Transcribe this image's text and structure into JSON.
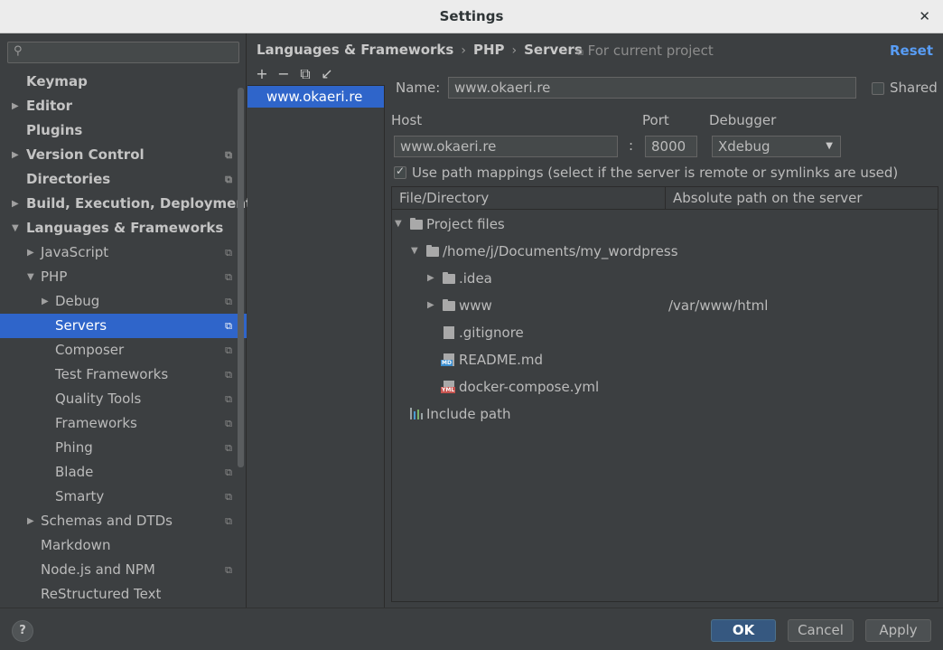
{
  "window": {
    "title": "Settings",
    "close_glyph": "✕"
  },
  "sidebar": {
    "search_placeholder": "",
    "search_icon": "search-icon",
    "items": [
      {
        "label": "Keymap"
      },
      {
        "label": "Editor"
      },
      {
        "label": "Plugins"
      },
      {
        "label": "Version Control"
      },
      {
        "label": "Directories"
      },
      {
        "label": "Build, Execution, Deployment"
      },
      {
        "label": "Languages & Frameworks"
      },
      {
        "label": "JavaScript"
      },
      {
        "label": "PHP"
      },
      {
        "label": "Debug"
      },
      {
        "label": "Servers"
      },
      {
        "label": "Composer"
      },
      {
        "label": "Test Frameworks"
      },
      {
        "label": "Quality Tools"
      },
      {
        "label": "Frameworks"
      },
      {
        "label": "Phing"
      },
      {
        "label": "Blade"
      },
      {
        "label": "Smarty"
      },
      {
        "label": "Schemas and DTDs"
      },
      {
        "label": "Markdown"
      },
      {
        "label": "Node.js and NPM"
      },
      {
        "label": "ReStructured Text"
      }
    ]
  },
  "header": {
    "breadcrumb": [
      "Languages & Frameworks",
      "PHP",
      "Servers"
    ],
    "breadcrumb_sep": "›",
    "scope_note": "For current project",
    "reset_label": "Reset"
  },
  "servers": {
    "toolbar": [
      "+",
      "−",
      "⧉",
      "↙"
    ],
    "list": [
      "www.okaeri.re"
    ]
  },
  "form": {
    "name_label": "Name:",
    "name_value": "www.okaeri.re",
    "shared_label": "Shared",
    "host_label": "Host",
    "host_value": "www.okaeri.re",
    "port_label": "Port",
    "port_sep": ":",
    "port_value": "8000",
    "debugger_label": "Debugger",
    "debugger_value": "Xdebug",
    "use_mappings_label": "Use path mappings (select if the server is remote or symlinks are used)"
  },
  "mappings": {
    "columns": [
      "File/Directory",
      "Absolute path on the server"
    ],
    "rows": [
      {
        "name": "Project files",
        "abs": ""
      },
      {
        "name": "/home/j/Documents/my_wordpress",
        "abs": ""
      },
      {
        "name": ".idea",
        "abs": ""
      },
      {
        "name": "www",
        "abs": "/var/www/html"
      },
      {
        "name": ".gitignore",
        "abs": "",
        "tag": ""
      },
      {
        "name": "README.md",
        "abs": "",
        "tag": "MD"
      },
      {
        "name": "docker-compose.yml",
        "abs": "",
        "tag": "YML"
      },
      {
        "name": "Include path",
        "abs": ""
      }
    ]
  },
  "footer": {
    "help_label": "?",
    "ok_label": "OK",
    "cancel_label": "Cancel",
    "apply_label": "Apply"
  },
  "colors": {
    "selection": "#2f65ca",
    "link": "#589df6",
    "primary_button": "#365880"
  }
}
